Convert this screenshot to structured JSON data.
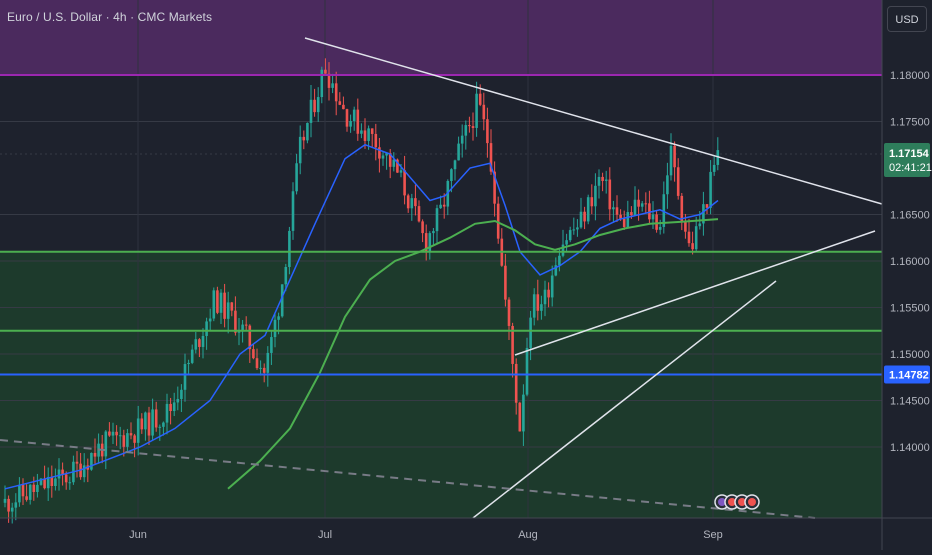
{
  "header": {
    "title": "Euro / U.S. Dollar · 4h · CMC Markets",
    "currency_button": "USD"
  },
  "colors": {
    "background": "#1e222d",
    "resistance_zone": "#4b2a5e",
    "resistance_line": "#9c27b0",
    "support_zone": "#1d3a2c",
    "support_line": "#4caf50",
    "blue_line": "#2962ff",
    "ma_fast": "#2962ff",
    "ma_slow": "#4caf50",
    "trendline": "#e0e3eb",
    "price_tag": "#2e7d5b",
    "blue_tag": "#2962ff"
  },
  "chart_data": {
    "type": "candlestick",
    "title": "Euro / U.S. Dollar · 4h · CMC Markets",
    "x_ticks": [
      "Jun",
      "Jul",
      "Aug",
      "Sep"
    ],
    "y_ticks": [
      "1.18000",
      "1.17500",
      "1.16500",
      "1.16000",
      "1.15500",
      "1.15000",
      "1.14500",
      "1.14000"
    ],
    "ylim": [
      1.1355,
      1.1878
    ],
    "current_price": "1.17154",
    "countdown": "02:41:21",
    "blue_level": "1.14782",
    "ohlc_overview": [
      {
        "date": "late May",
        "close": 1.136
      },
      {
        "date": "early Jun",
        "close": 1.139
      },
      {
        "date": "mid Jun",
        "close": 1.152
      },
      {
        "date": "late Jun",
        "close": 1.174
      },
      {
        "date": "Jul 1",
        "close": 1.182
      },
      {
        "date": "mid Jul",
        "close": 1.165
      },
      {
        "date": "late Jul",
        "close": 1.178
      },
      {
        "date": "Aug 1",
        "close": 1.14
      },
      {
        "date": "mid Aug",
        "close": 1.168
      },
      {
        "date": "late Aug",
        "close": 1.16
      },
      {
        "date": "Sep",
        "close": 1.1715
      }
    ],
    "levels": [
      {
        "price": 1.18,
        "kind": "resistance"
      },
      {
        "price": 1.161,
        "kind": "support"
      },
      {
        "price": 1.1525,
        "kind": "support"
      },
      {
        "price": 1.1478,
        "kind": "blue"
      }
    ]
  }
}
